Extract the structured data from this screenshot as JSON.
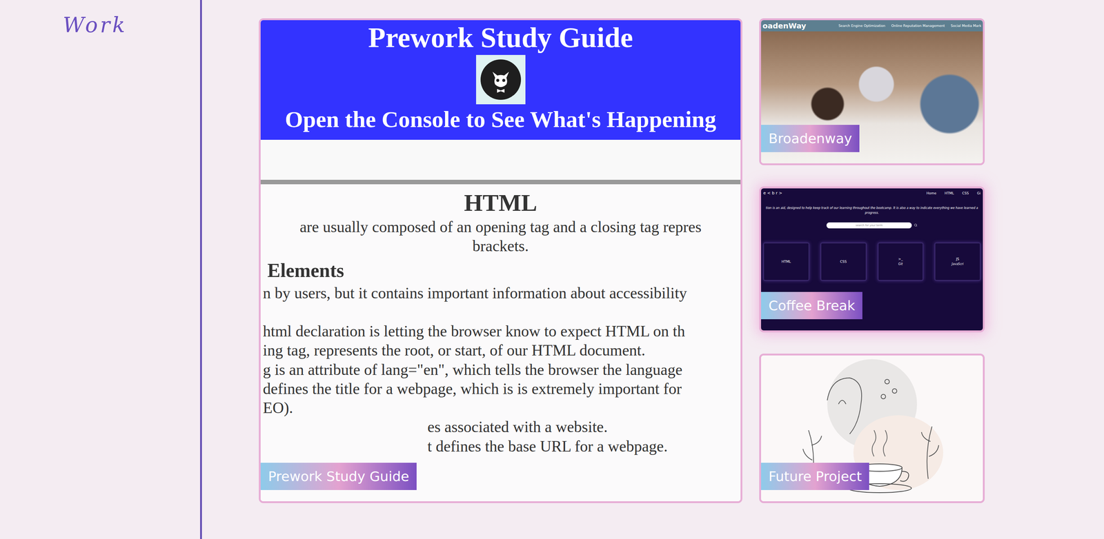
{
  "sidebar": {
    "heading": "Work"
  },
  "projects": [
    {
      "kind": "study-guide",
      "label": "Prework Study Guide",
      "highlighted": false,
      "screen": {
        "title": "Prework Study Guide",
        "subtitle": "Open the Console to See What's Happening",
        "section": "HTML",
        "intro": [
          "are usually composed of an opening tag and a closing tag repres",
          "brackets."
        ],
        "subsection": "Elements",
        "notes": [
          "n by users, but it contains important information about accessibility"
        ],
        "details": [
          "html declaration is letting the browser know to expect HTML on th",
          "ing tag, represents the root, or start, of our HTML document.",
          "g is an attribute of lang=\"en\", which tells the browser the language",
          "defines the title for a webpage, which is is extremely important for",
          "EO).",
          "es associated with a website.",
          "t defines the base URL for a webpage."
        ]
      }
    },
    {
      "kind": "broadenway",
      "label": "Broadenway",
      "highlighted": false,
      "screen": {
        "brand": "oadenWay",
        "links": [
          "Search Engine Optimization",
          "Online Reputation Management",
          "Social Media Mark"
        ]
      }
    },
    {
      "kind": "coffee-break",
      "label": "Coffee Break",
      "highlighted": true,
      "screen": {
        "logo": "e  < b r >",
        "links": [
          "Home",
          "HTML",
          "CSS",
          "Gi"
        ],
        "tagline": "tion is an aid, designed to help keep track of our learning throughout the bootcamp. It is also a way to indicate everything we have learned a",
        "tagline_end": "progress.",
        "search_placeholder": "search for your term",
        "tiles": [
          {
            "mark": "HTML",
            "caption": ""
          },
          {
            "mark": "CSS",
            "caption": ""
          },
          {
            "mark": ">_",
            "caption": "Git"
          },
          {
            "mark": "JS",
            "caption": "JavaScri"
          }
        ]
      }
    },
    {
      "kind": "future",
      "label": "Future Project",
      "highlighted": false,
      "screen": {}
    }
  ]
}
